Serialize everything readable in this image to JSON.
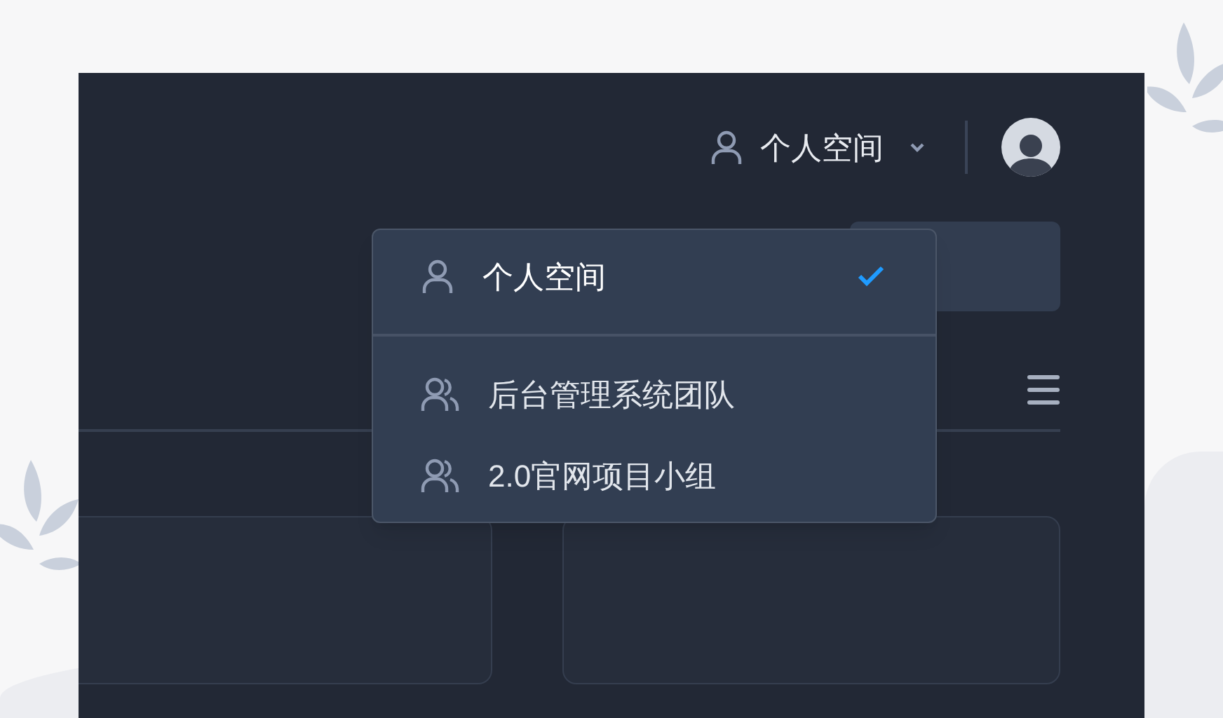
{
  "header": {
    "workspace": "个人空间",
    "menu_expanded": true
  },
  "workspace_menu": [
    {
      "label": "个人空间",
      "kind": "personal",
      "selected": true
    },
    {
      "label": "后台管理系统团队",
      "kind": "team",
      "selected": false
    },
    {
      "label": "2.0官网项目小组",
      "kind": "team",
      "selected": false
    }
  ]
}
